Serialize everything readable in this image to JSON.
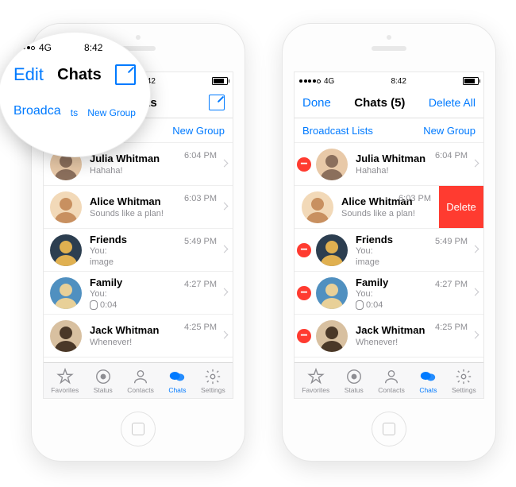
{
  "status": {
    "carrier": "4G",
    "time": "8:42"
  },
  "nav_left": {
    "edit": "Edit",
    "title": "Chats"
  },
  "nav_right": {
    "done": "Done",
    "title": "Chats (5)",
    "delete_all": "Delete All"
  },
  "sub": {
    "broadcast": "Broadcast Lists",
    "newgroup": "New Group"
  },
  "mag": {
    "edit": "Edit",
    "title": "Chats",
    "broadcast": "Broadca",
    "lists_frag": "ts",
    "newgroup": "New Group"
  },
  "chats": [
    {
      "name": "Julia Whitman",
      "msg": "Hahaha!",
      "time": "6:04 PM",
      "minus": true
    },
    {
      "name": "Alice Whitman",
      "msg": "Sounds like a plan!",
      "time": "6:03 PM",
      "swipe": true
    },
    {
      "name": "Friends",
      "msg_prefix": "You:",
      "msg": "image",
      "time": "5:49 PM",
      "minus": true
    },
    {
      "name": "Family",
      "msg_prefix": "You:",
      "msg": "0:04",
      "time": "4:27 PM",
      "voice": true,
      "minus": true
    },
    {
      "name": "Jack Whitman",
      "msg": "Whenever!",
      "time": "4:25 PM",
      "minus": true
    }
  ],
  "delete_label": "Delete",
  "tabs": [
    {
      "label": "Favorites"
    },
    {
      "label": "Status"
    },
    {
      "label": "Contacts"
    },
    {
      "label": "Chats",
      "active": true
    },
    {
      "label": "Settings"
    }
  ]
}
